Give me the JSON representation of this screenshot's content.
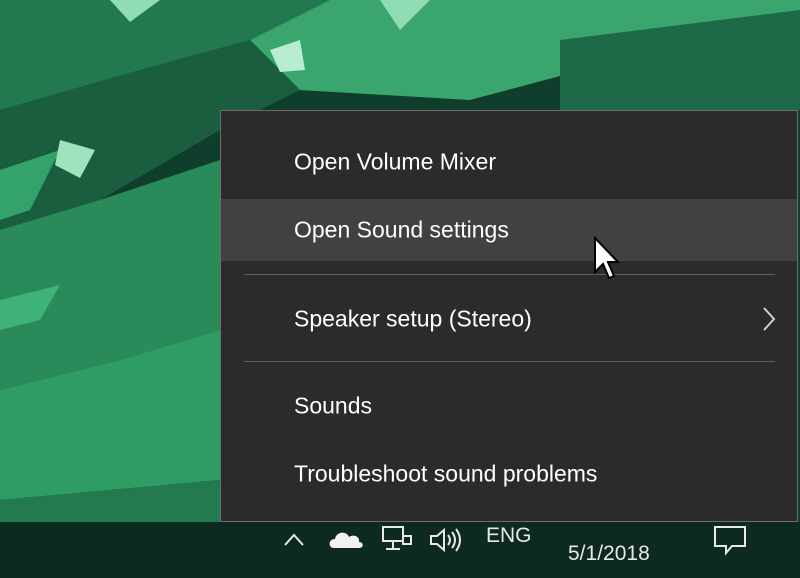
{
  "context_menu": {
    "items": [
      {
        "label": "Open Volume Mixer"
      },
      {
        "label": "Open Sound settings",
        "hovered": true
      },
      {
        "label": "Speaker setup (Stereo)",
        "has_submenu": true
      },
      {
        "label": "Sounds"
      },
      {
        "label": "Troubleshoot sound problems"
      }
    ]
  },
  "taskbar": {
    "language": "ENG",
    "date": "5/1/2018",
    "icons": [
      "chevron-up-icon",
      "onedrive-cloud-icon",
      "network-icon",
      "volume-icon",
      "action-center-icon"
    ]
  },
  "colors": {
    "menu_bg": "#2b2b2b",
    "menu_hover": "#414141",
    "menu_text": "#ffffff",
    "taskbar_bg": "#0c2a1f",
    "wallpaper_green": "#2fa46a"
  }
}
